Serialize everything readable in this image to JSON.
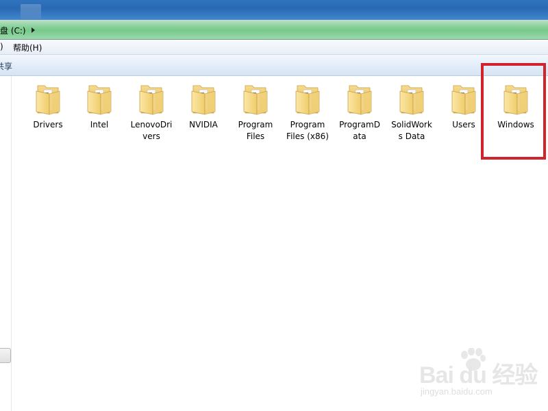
{
  "address_bar": {
    "path_segment": "盘 (C:)"
  },
  "menu_bar": {
    "partial_item": ")",
    "help_item": "帮助(H)"
  },
  "command_bar": {
    "partial_item": "共享"
  },
  "folders": [
    {
      "label": "Drivers",
      "icon": "folder-icon"
    },
    {
      "label": "Intel",
      "icon": "folder-icon"
    },
    {
      "label": "LenovoDri\nvers",
      "icon": "folder-icon"
    },
    {
      "label": "NVIDIA",
      "icon": "folder-icon"
    },
    {
      "label": "Program\nFiles",
      "icon": "folder-icon"
    },
    {
      "label": "Program\nFiles (x86)",
      "icon": "folder-icon"
    },
    {
      "label": "ProgramD\nata",
      "icon": "folder-icon"
    },
    {
      "label": "SolidWork\ns Data",
      "icon": "folder-icon"
    },
    {
      "label": "Users",
      "icon": "folder-icon"
    },
    {
      "label": "Windows",
      "icon": "folder-icon"
    }
  ],
  "highlight": {
    "target": "Windows",
    "color": "#d0232c"
  },
  "watermark": {
    "main_text": "Bai du 经验",
    "sub_text": "jingyan.baidu.com"
  },
  "colors": {
    "address_bar_green": "#77c98a",
    "folder_yellow": "#f3d27a",
    "titlebar_blue": "#2f74bf"
  }
}
